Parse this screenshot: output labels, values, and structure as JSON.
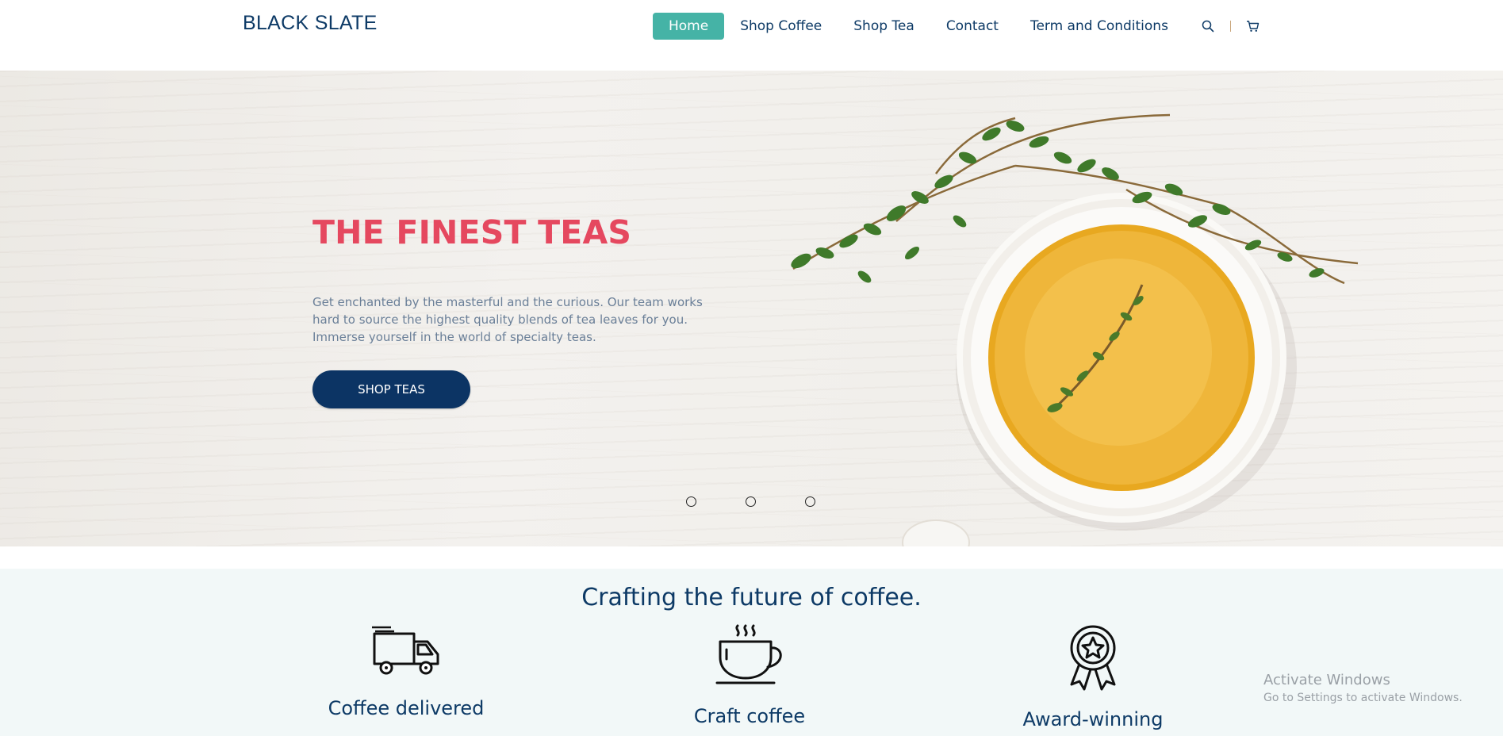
{
  "header": {
    "logo": "BLACK SLATE",
    "nav": [
      {
        "label": "Home",
        "active": true
      },
      {
        "label": "Shop Coffee",
        "active": false
      },
      {
        "label": "Shop Tea",
        "active": false
      },
      {
        "label": "Contact",
        "active": false
      },
      {
        "label": "Term and Conditions",
        "active": false
      }
    ],
    "icons": [
      "search-icon",
      "cart-icon"
    ]
  },
  "hero": {
    "title": "THE FINEST TEAS",
    "text": "Get enchanted by the masterful and the curious. Our team works hard to source the highest quality blends of tea leaves for you. Immerse yourself in the world of specialty teas.",
    "button": "SHOP TEAS",
    "slides": 3
  },
  "features": {
    "title": "Crafting the future of coffee.",
    "items": [
      {
        "icon": "truck-icon",
        "label": "Coffee delivered"
      },
      {
        "icon": "coffee-cup-icon",
        "label": "Craft coffee"
      },
      {
        "icon": "award-icon",
        "label": "Award-winning"
      }
    ]
  },
  "watermark": {
    "title": "Activate Windows",
    "subtitle": "Go to Settings to activate Windows."
  },
  "colors": {
    "brand": "#0d3a66",
    "accent": "#45b3a6",
    "hero_title": "#e5485f",
    "button": "#0c3464"
  }
}
